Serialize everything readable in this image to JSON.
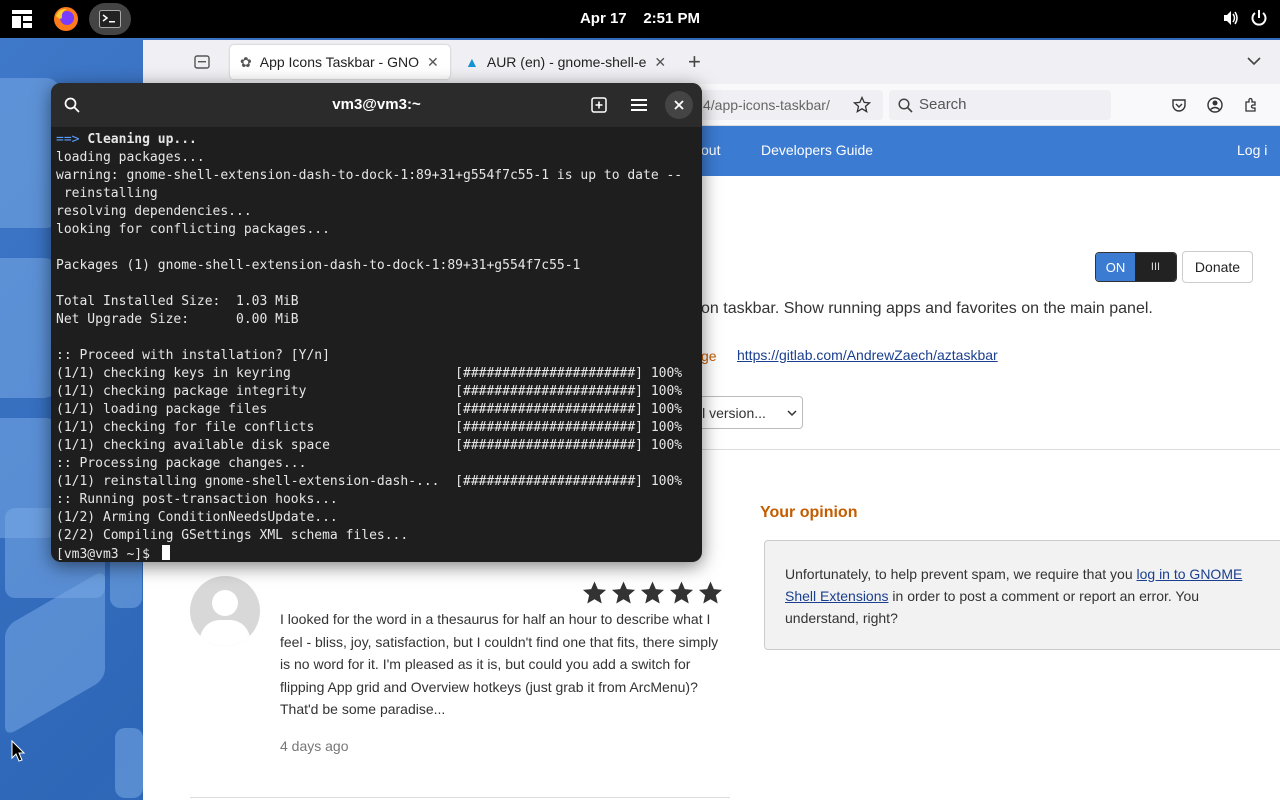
{
  "topbar": {
    "date": "Apr 17",
    "time": "2:51 PM",
    "icons": [
      "apps-grid-icon",
      "firefox-icon",
      "terminal-icon",
      "volume-icon",
      "power-icon"
    ]
  },
  "browser": {
    "tabs": [
      {
        "label": "App Icons Taskbar - GNO"
      },
      {
        "label": "AUR (en) - gnome-shell-e"
      }
    ],
    "url_tail": "4/app-icons-taskbar/",
    "search_placeholder": "Search",
    "nav": {
      "about": "out",
      "developers_guide": "Developers Guide",
      "login": "Log i"
    },
    "toggle_on": "ON",
    "toggle_off": "III",
    "donate": "Donate",
    "description": "on taskbar. Show running apps and favorites on the main panel.",
    "homepage_label": "ge",
    "homepage_url": "https://gitlab.com/AndrewZaech/aztaskbar",
    "version_select": "ll version...",
    "your_opinion": "Your opinion",
    "notice_pre": "Unfortunately, to help prevent spam, we require that you ",
    "notice_link": "log in to GNOME Shell Extensions",
    "notice_post": " in order to post a comment or report an error. You understand, right?",
    "review_text": "I looked for the word in a thesaurus for half an hour to describe what I feel - bliss, joy, satisfaction, but I couldn't find one that fits, there simply is no word for it. I'm pleased as it is, but could you add a switch for flipping App grid and Overview hotkeys (just grab it from ArcMenu)? That'd be some paradise...",
    "review_age": "4 days ago",
    "rating_stars": 5
  },
  "terminal": {
    "title": "vm3@vm3:~",
    "lines": [
      "==> Cleaning up...",
      "loading packages...",
      "warning: gnome-shell-extension-dash-to-dock-1:89+31+g554f7c55-1 is up to date --",
      " reinstalling",
      "resolving dependencies...",
      "looking for conflicting packages...",
      "",
      "Packages (1) gnome-shell-extension-dash-to-dock-1:89+31+g554f7c55-1",
      "",
      "Total Installed Size:  1.03 MiB",
      "Net Upgrade Size:      0.00 MiB",
      "",
      ":: Proceed with installation? [Y/n]",
      "(1/1) checking keys in keyring                     [######################] 100%",
      "(1/1) checking package integrity                   [######################] 100%",
      "(1/1) loading package files                        [######################] 100%",
      "(1/1) checking for file conflicts                  [######################] 100%",
      "(1/1) checking available disk space                [######################] 100%",
      ":: Processing package changes...",
      "(1/1) reinstalling gnome-shell-extension-dash-...  [######################] 100%",
      ":: Running post-transaction hooks...",
      "(1/2) Arming ConditionNeedsUpdate...",
      "(2/2) Compiling GSettings XML schema files...",
      "[vm3@vm3 ~]$ "
    ]
  }
}
